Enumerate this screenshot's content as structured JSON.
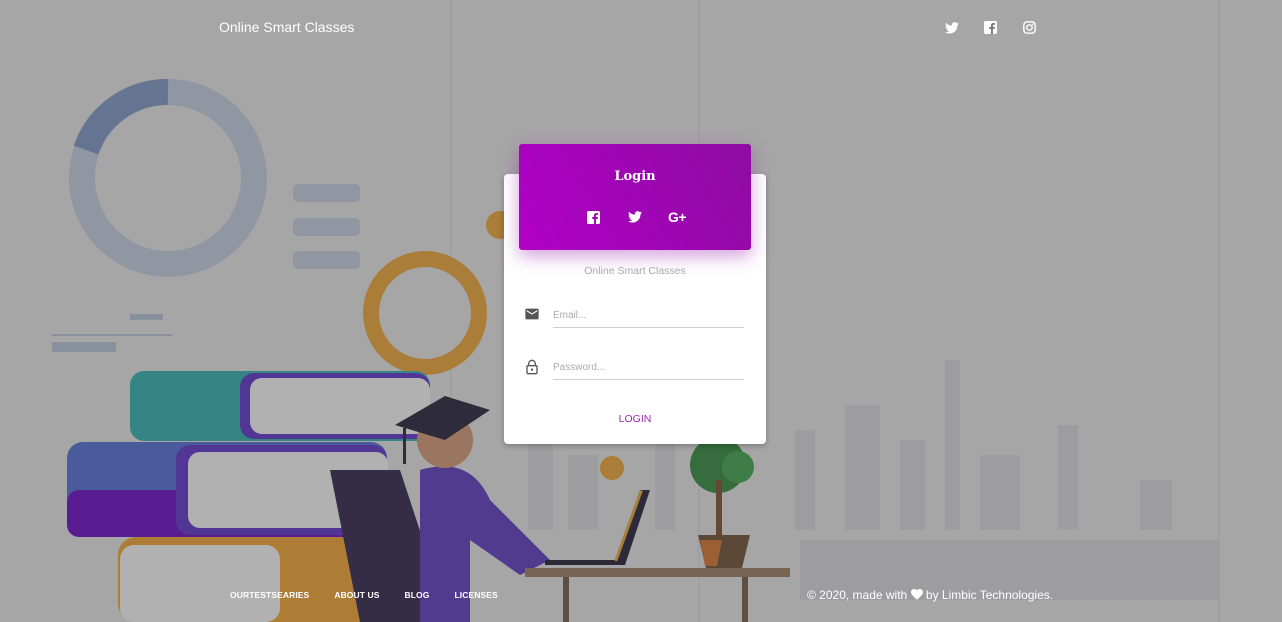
{
  "navbar": {
    "brand": "Online Smart Classes",
    "social_icons": [
      "twitter-icon",
      "facebook-icon",
      "instagram-icon"
    ]
  },
  "login_card": {
    "title": "Login",
    "header_icons": [
      "facebook-icon",
      "twitter-icon",
      "google-plus-icon"
    ],
    "google_plus_glyph": "G+",
    "description": "Online Smart Classes",
    "email": {
      "placeholder": "Email...",
      "value": "",
      "icon": "envelope-icon"
    },
    "password": {
      "placeholder": "Password...",
      "value": "",
      "icon": "lock-icon"
    },
    "submit_label": "LOGIN",
    "header_gradient": [
      "#b100c6",
      "#8e0ba2"
    ],
    "accent": "#9c27b0"
  },
  "footer": {
    "links": [
      "OURTESTSEARIES",
      "ABOUT US",
      "BLOG",
      "LICENSES"
    ],
    "copyright_prefix": "© 2020, made with",
    "copyright_suffix": "by Limbic Technologies."
  }
}
